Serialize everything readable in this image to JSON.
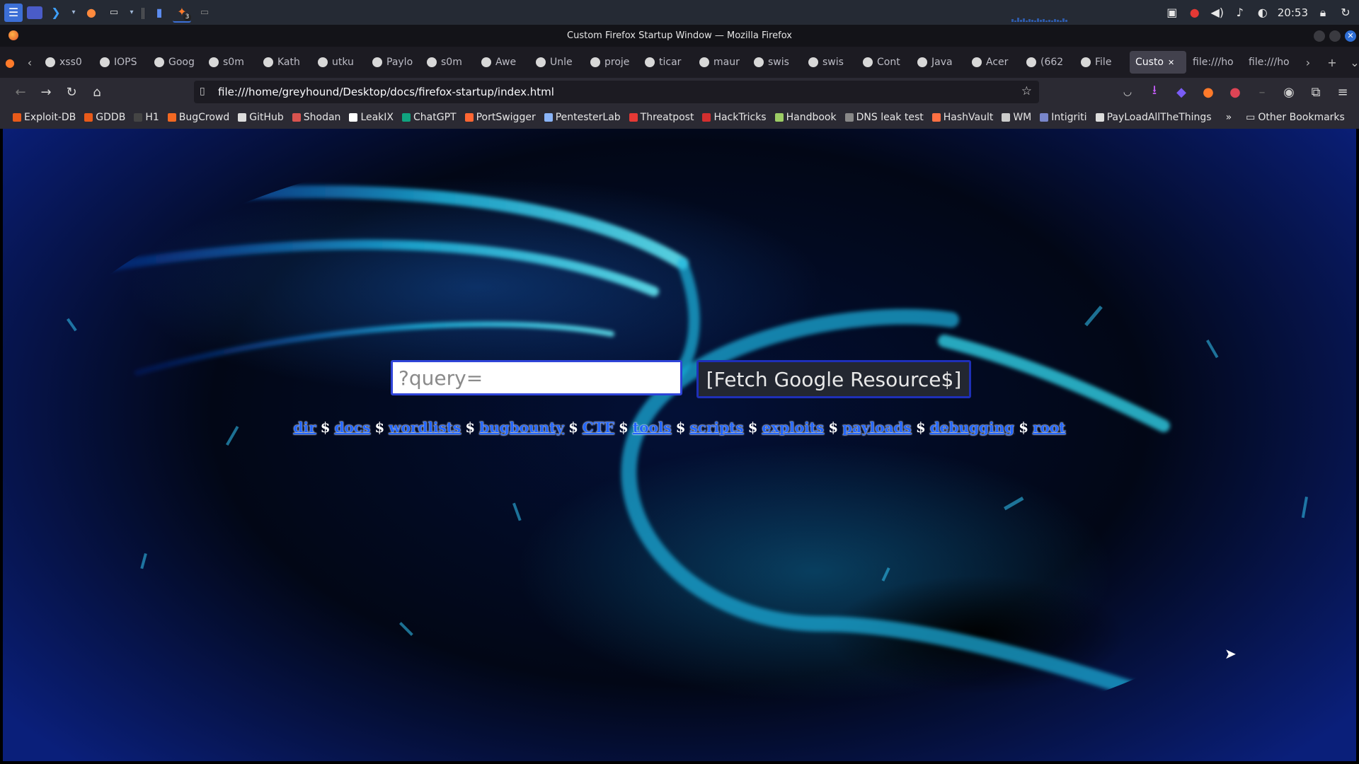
{
  "taskbar": {
    "clock": "20:53",
    "apps": [
      "kali-menu-icon",
      "desktop-icon",
      "vscode-icon",
      "chevron-down-icon",
      "firefox-icon",
      "terminal-icon",
      "chevron-down-icon",
      "separator",
      "files-icon",
      "burp-icon",
      "window-icon"
    ],
    "burp_badge": "3"
  },
  "window": {
    "title": "Custom Firefox Startup Window — Mozilla Firefox"
  },
  "tabs": [
    {
      "label": "xss0",
      "icon": "tab-icon"
    },
    {
      "label": "IOPS",
      "icon": "tab-icon"
    },
    {
      "label": "Goog",
      "icon": "blogger-icon"
    },
    {
      "label": "s0m",
      "icon": "github-icon"
    },
    {
      "label": "Kath",
      "icon": "github-icon"
    },
    {
      "label": "utku",
      "icon": "github-icon"
    },
    {
      "label": "Paylo",
      "icon": "github-icon"
    },
    {
      "label": "s0m",
      "icon": "github-icon"
    },
    {
      "label": "Awe",
      "icon": "github-icon"
    },
    {
      "label": "Unle",
      "icon": "github-icon"
    },
    {
      "label": "proje",
      "icon": "github-icon"
    },
    {
      "label": "ticar",
      "icon": "github-icon"
    },
    {
      "label": "maur",
      "icon": "github-icon"
    },
    {
      "label": "swis",
      "icon": "github-icon"
    },
    {
      "label": "swis",
      "icon": "github-icon"
    },
    {
      "label": "Cont",
      "icon": "medium-icon"
    },
    {
      "label": "Java",
      "icon": "w-icon"
    },
    {
      "label": "Acer",
      "icon": "tab-icon"
    },
    {
      "label": "(662",
      "icon": "tab-icon"
    },
    {
      "label": "File",
      "icon": "tab-icon"
    },
    {
      "label": "Custo",
      "icon": "",
      "active": true
    },
    {
      "label": "file:///ho",
      "icon": ""
    },
    {
      "label": "file:///ho",
      "icon": ""
    }
  ],
  "navbar": {
    "url": "file:///home/greyhound/Desktop/docs/firefox-startup/index.html"
  },
  "bookmarks": [
    {
      "label": "Exploit-DB",
      "color": "#e85a1a"
    },
    {
      "label": "GDDB",
      "color": "#e85a1a"
    },
    {
      "label": "H1",
      "color": "#444"
    },
    {
      "label": "BugCrowd",
      "color": "#f26822"
    },
    {
      "label": "GitHub",
      "color": "#ddd"
    },
    {
      "label": "Shodan",
      "color": "#d9534f"
    },
    {
      "label": "LeakIX",
      "color": "#fff"
    },
    {
      "label": "ChatGPT",
      "color": "#10a37f"
    },
    {
      "label": "PortSwigger",
      "color": "#ff6633"
    },
    {
      "label": "PentesterLab",
      "color": "#8ab4f8"
    },
    {
      "label": "Threatpost",
      "color": "#e53935"
    },
    {
      "label": "HackTricks",
      "color": "#d32f2f"
    },
    {
      "label": "Handbook",
      "color": "#9ccc65"
    },
    {
      "label": "DNS leak test",
      "color": "#888"
    },
    {
      "label": "HashVault",
      "color": "#ff7043"
    },
    {
      "label": "WM",
      "color": "#ccc"
    },
    {
      "label": "Intigriti",
      "color": "#7986cb"
    },
    {
      "label": "PayLoadAllTheThings",
      "color": "#ddd"
    }
  ],
  "bookmarks_other": "Other Bookmarks",
  "page": {
    "query_placeholder": "?query=",
    "fetch_label": "[Fetch Google Resource$]",
    "links": [
      "dir",
      "docs",
      "wordlists",
      "bugbounty",
      "CTF",
      "tools",
      "scripts",
      "exploits",
      "payloads",
      "debugging",
      "root"
    ],
    "separator": "$"
  },
  "colors": {
    "accent": "#2f44d8",
    "link": "#2266ff"
  }
}
